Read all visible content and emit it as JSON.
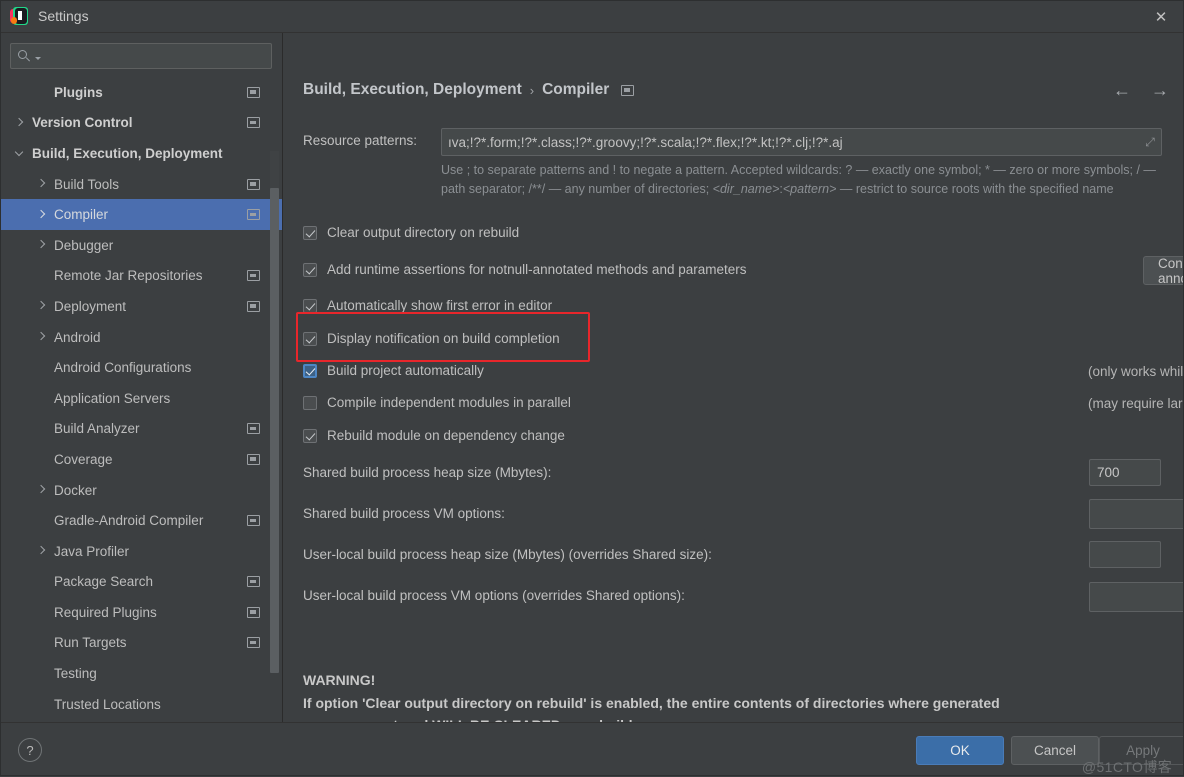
{
  "window": {
    "title": "Settings",
    "app_icon": "intellij-idea-icon",
    "close_label": "✕"
  },
  "sidebar": {
    "search": {
      "placeholder": "",
      "value": "",
      "icon": "search-icon"
    },
    "items": [
      {
        "label": "Plugins",
        "indent": 1,
        "arrow": "none",
        "bold": true,
        "badge": true,
        "selected": false
      },
      {
        "label": "Version Control",
        "indent": 0,
        "arrow": "right",
        "bold": true,
        "badge": true,
        "selected": false
      },
      {
        "label": "Build, Execution, Deployment",
        "indent": 0,
        "arrow": "down",
        "bold": true,
        "badge": false,
        "selected": false
      },
      {
        "label": "Build Tools",
        "indent": 1,
        "arrow": "right",
        "bold": false,
        "badge": true,
        "selected": false
      },
      {
        "label": "Compiler",
        "indent": 1,
        "arrow": "right",
        "bold": false,
        "badge": true,
        "selected": true
      },
      {
        "label": "Debugger",
        "indent": 1,
        "arrow": "right",
        "bold": false,
        "badge": false,
        "selected": false
      },
      {
        "label": "Remote Jar Repositories",
        "indent": 1,
        "arrow": "none",
        "bold": false,
        "badge": true,
        "selected": false
      },
      {
        "label": "Deployment",
        "indent": 1,
        "arrow": "right",
        "bold": false,
        "badge": true,
        "selected": false
      },
      {
        "label": "Android",
        "indent": 1,
        "arrow": "right",
        "bold": false,
        "badge": false,
        "selected": false
      },
      {
        "label": "Android Configurations",
        "indent": 1,
        "arrow": "none",
        "bold": false,
        "badge": false,
        "selected": false
      },
      {
        "label": "Application Servers",
        "indent": 1,
        "arrow": "none",
        "bold": false,
        "badge": false,
        "selected": false
      },
      {
        "label": "Build Analyzer",
        "indent": 1,
        "arrow": "none",
        "bold": false,
        "badge": true,
        "selected": false
      },
      {
        "label": "Coverage",
        "indent": 1,
        "arrow": "none",
        "bold": false,
        "badge": true,
        "selected": false
      },
      {
        "label": "Docker",
        "indent": 1,
        "arrow": "right",
        "bold": false,
        "badge": false,
        "selected": false
      },
      {
        "label": "Gradle-Android Compiler",
        "indent": 1,
        "arrow": "none",
        "bold": false,
        "badge": true,
        "selected": false
      },
      {
        "label": "Java Profiler",
        "indent": 1,
        "arrow": "right",
        "bold": false,
        "badge": false,
        "selected": false
      },
      {
        "label": "Package Search",
        "indent": 1,
        "arrow": "none",
        "bold": false,
        "badge": true,
        "selected": false
      },
      {
        "label": "Required Plugins",
        "indent": 1,
        "arrow": "none",
        "bold": false,
        "badge": true,
        "selected": false
      },
      {
        "label": "Run Targets",
        "indent": 1,
        "arrow": "none",
        "bold": false,
        "badge": true,
        "selected": false
      },
      {
        "label": "Testing",
        "indent": 1,
        "arrow": "none",
        "bold": false,
        "badge": false,
        "selected": false
      },
      {
        "label": "Trusted Locations",
        "indent": 1,
        "arrow": "none",
        "bold": false,
        "badge": false,
        "selected": false
      }
    ]
  },
  "breadcrumb": {
    "parent": "Build, Execution, Deployment",
    "separator": "›",
    "current": "Compiler"
  },
  "nav": {
    "back": "←",
    "forward": "→"
  },
  "resource_patterns": {
    "label": "Resource patterns:",
    "value": "ıva;!?*.form;!?*.class;!?*.groovy;!?*.scala;!?*.flex;!?*.kt;!?*.clj;!?*.aj",
    "expand_icon": "⤢",
    "hint": "Use ; to separate patterns and ! to negate a pattern. Accepted wildcards: ? — exactly one symbol; * — zero or more symbols; / — path separator; /**/ — any number of directories;  <dir_name>:<pattern> — restrict to source roots with the specified name"
  },
  "checkboxes": [
    {
      "label": "Clear output directory on rebuild",
      "checked": true,
      "focused": false,
      "note": ""
    },
    {
      "label": "Add runtime assertions for notnull-annotated methods and parameters",
      "checked": true,
      "focused": false,
      "note": ""
    },
    {
      "label": "Automatically show first error in editor",
      "checked": true,
      "focused": false,
      "note": ""
    },
    {
      "label": "Display notification on build completion",
      "checked": true,
      "focused": false,
      "note": ""
    },
    {
      "label": "Build project automatically",
      "checked": true,
      "focused": true,
      "note": "(only works while not running / debugging)"
    },
    {
      "label": "Compile independent modules in parallel",
      "checked": false,
      "focused": false,
      "note": "(may require larger heap size)"
    },
    {
      "label": "Rebuild module on dependency change",
      "checked": true,
      "focused": false,
      "note": ""
    }
  ],
  "configure_annotations_button": "Configure annotations...",
  "fields": [
    {
      "label": "Shared build process heap size (Mbytes):",
      "value": "700",
      "expandable": false
    },
    {
      "label": "Shared build process VM options:",
      "value": "",
      "expandable": true
    },
    {
      "label": "User-local build process heap size (Mbytes) (overrides Shared size):",
      "value": "",
      "expandable": false
    },
    {
      "label": "User-local build process VM options (overrides Shared options):",
      "value": "",
      "expandable": true
    }
  ],
  "warning": {
    "title": "WARNING!",
    "line1": "If option 'Clear output directory on rebuild' is enabled, the entire contents of directories where generated",
    "line2": "sources are stored WILL BE CLEARED on rebuild."
  },
  "footer": {
    "help": "?",
    "ok": "OK",
    "cancel": "Cancel",
    "apply": "Apply",
    "watermark": "@51CTO博客"
  },
  "colors": {
    "selection_blue": "#4b6eaf",
    "primary_button": "#3b6ea8",
    "annotation_red": "#e8262b",
    "focus_blue": "#4d86c4",
    "background": "#3c3f41"
  }
}
